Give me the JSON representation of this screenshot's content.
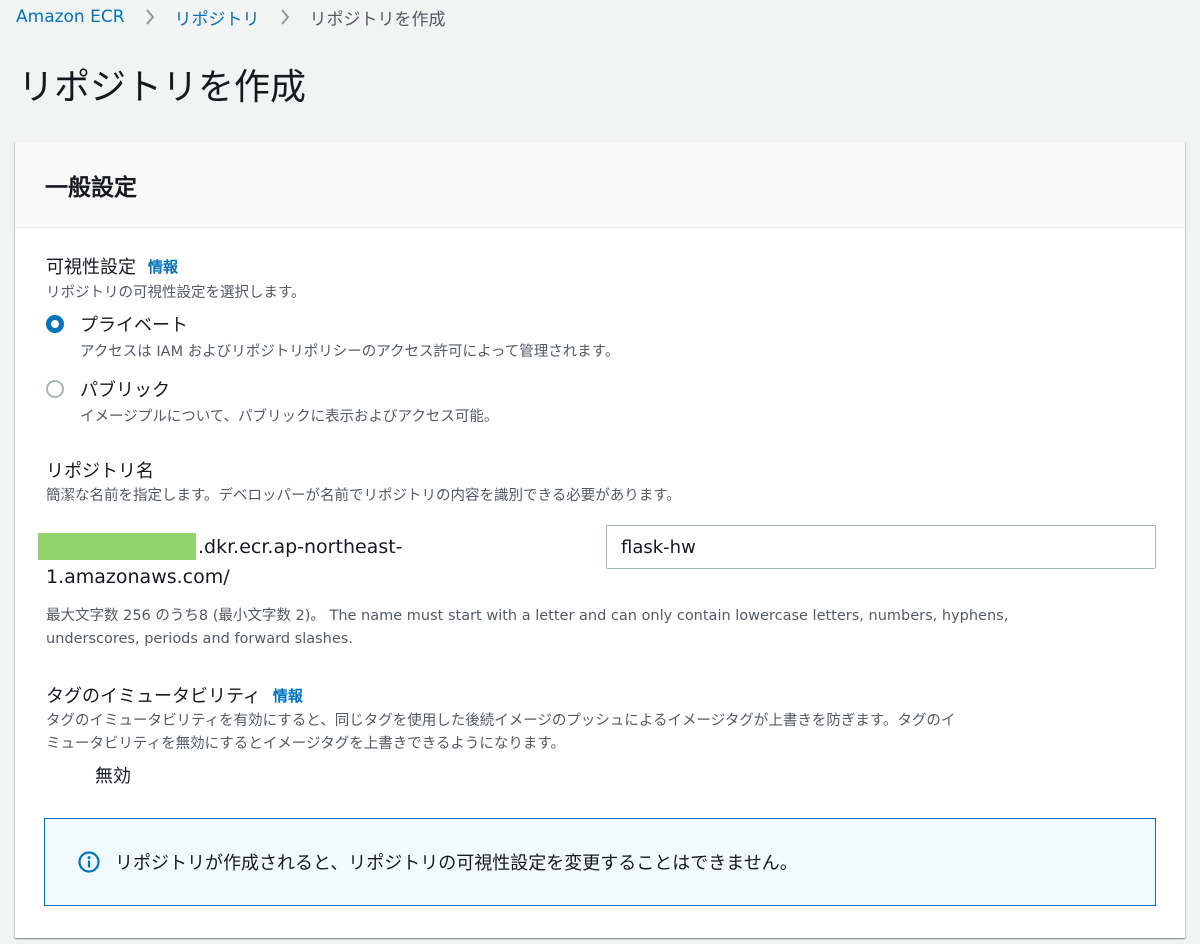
{
  "breadcrumb": {
    "items": [
      "Amazon ECR",
      "リポジトリ"
    ],
    "current": "リポジトリを作成"
  },
  "page": {
    "title": "リポジトリを作成"
  },
  "general": {
    "heading": "一般設定",
    "visibility": {
      "label": "可視性設定",
      "info": "情報",
      "description": "リポジトリの可視性設定を選択します。",
      "options": [
        {
          "label": "プライベート",
          "description": "アクセスは IAM およびリポジトリポリシーのアクセス許可によって管理されます。",
          "selected": true
        },
        {
          "label": "パブリック",
          "description": "イメージプルについて、パブリックに表示およびアクセス可能。",
          "selected": false
        }
      ]
    },
    "repo_name": {
      "label": "リポジトリ名",
      "description": "簡潔な名前を指定します。デベロッパーが名前でリポジトリの内容を識別できる必要があります。",
      "uri_suffix_line1": ".dkr.ecr.ap-northeast-",
      "uri_suffix_line2": "1.amazonaws.com/",
      "value": "flask-hw",
      "hint_line1": "最大文字数 256 のうち8 (最小文字数 2)。 The name must start with a letter and can only contain lowercase letters, numbers, hyphens,",
      "hint_line2": "underscores, periods and forward slashes.",
      "masked_color": "#92d36e"
    },
    "tag_immutability": {
      "label": "タグのイミュータビリティ",
      "info": "情報",
      "description_line1": "タグのイミュータビリティを有効にすると、同じタグを使用した後続イメージのプッシュによるイメージタグが上書きを防ぎます。タグのイ",
      "description_line2": "ミュータビリティを無効にするとイメージタグを上書きできるようになります。",
      "toggle_label": "無効",
      "enabled": false
    },
    "alert": {
      "icon": "info-icon",
      "text": "リポジトリが作成されると、リポジトリの可視性設定を変更することはできません。"
    }
  },
  "colors": {
    "link": "#0073bb",
    "background": "#f2f3f3",
    "alert_bg": "#f1faff"
  }
}
